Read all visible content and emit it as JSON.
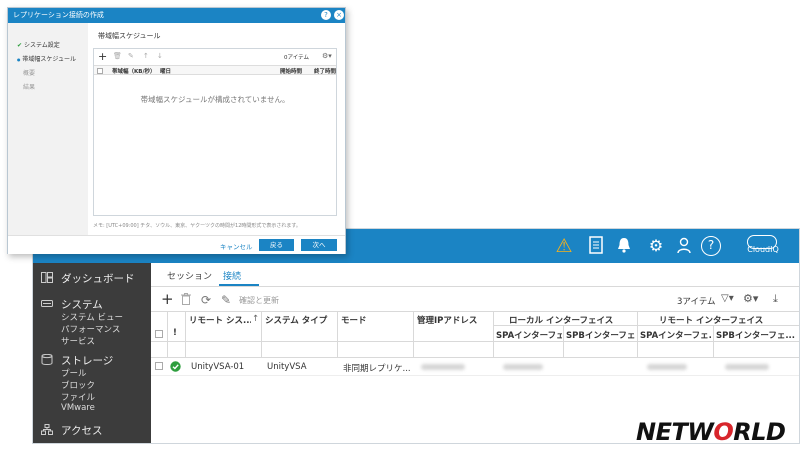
{
  "main": {
    "topbar": {
      "icons": [
        "warning-icon",
        "document-icon",
        "bell-icon",
        "gear-icon",
        "user-icon",
        "help-icon"
      ],
      "help_glyph": "?",
      "cloudiq_label": "CloudIQ"
    },
    "sidebar": {
      "items": [
        {
          "label": "ダッシュボード",
          "icon": "dashboard-icon"
        },
        {
          "label": "システム",
          "icon": "system-icon",
          "children": [
            "システム ビュー",
            "パフォーマンス",
            "サービス"
          ]
        },
        {
          "label": "ストレージ",
          "icon": "storage-icon",
          "children": [
            "プール",
            "ブロック",
            "ファイル",
            "VMware"
          ]
        },
        {
          "label": "アクセス",
          "icon": "access-icon"
        }
      ]
    },
    "tabs": [
      {
        "label": "セッション",
        "active": false
      },
      {
        "label": "接続",
        "active": true
      }
    ],
    "toolbar": {
      "add_glyph": "+",
      "sync_label": "確認と更新",
      "item_count": "3アイテム"
    },
    "table": {
      "headers": {
        "remote_system": "リモート シス...",
        "sort_indicator": "↑",
        "system_type": "システム タイプ",
        "mode": "モード",
        "mgmt_ip": "管理IPアドレス",
        "local_if": "ローカル インターフェイス",
        "remote_if": "リモート インターフェイス",
        "spa_if": "SPAインターフェ...",
        "spb_if": "SPBインターフェ...",
        "alert_col": "!"
      },
      "rows": [
        {
          "remote_system": "UnityVSA-01",
          "system_type": "UnityVSA",
          "mode": "非同期レプリケ..."
        }
      ]
    }
  },
  "dialog": {
    "title": "レプリケーション接続の作成",
    "help_glyph": "?",
    "close_glyph": "×",
    "steps": [
      {
        "label": "システム設定",
        "state": "done",
        "mark": "✔"
      },
      {
        "label": "帯域幅スケジュール",
        "state": "current",
        "mark": "●"
      },
      {
        "label": "概要",
        "state": "pending"
      },
      {
        "label": "結果",
        "state": "pending"
      }
    ],
    "section_title": "帯域幅スケジュール",
    "toolbar": {
      "add_glyph": "+",
      "item_count": "0アイテム"
    },
    "columns": [
      "帯域幅（KB/秒）",
      "曜日",
      "開始時間",
      "終了時間"
    ],
    "empty_message": "帯域幅スケジュールが構成されていません。",
    "note": "メモ: [UTC+09:00] チタ、ソウル、東京、ヤクーツクの時間が12時間形式で表示されます。",
    "buttons": {
      "cancel": "キャンセル",
      "back": "戻る",
      "next": "次へ"
    }
  },
  "logo": {
    "text_before": "NETW",
    "text_o": "O",
    "text_after": "RLD"
  },
  "colors": {
    "accent": "#1b84c4",
    "sidebar_bg": "#3c3c3c",
    "ok": "#2e9e3e",
    "warning": "#f2b01e",
    "logo_red": "#d8262c"
  }
}
